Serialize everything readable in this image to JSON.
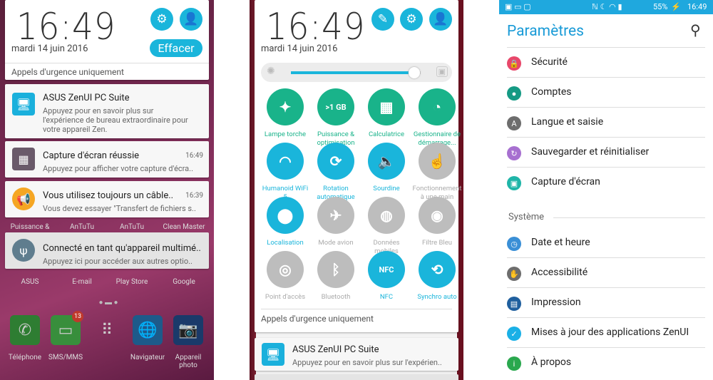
{
  "panel1": {
    "time": "16:49",
    "date": "mardi 14 juin 2016",
    "clear_label": "Effacer",
    "emergency": "Appels d'urgence uniquement",
    "notifications": [
      {
        "title": "ASUS ZenUI PC Suite",
        "text": [
          "Appuyez pour en savoir plus sur",
          "l'expérience de bureau extraordinaire pour",
          "votre appareil Zen."
        ],
        "time": ""
      },
      {
        "title": "Capture d'écran réussie",
        "text": [
          "Appuyez pour afficher votre capture d'écra.."
        ],
        "time": "16:49"
      },
      {
        "title": "Vous utilisez toujours un câble..",
        "text": [
          "Vous devez essayer \"Transfert de fichiers s.."
        ],
        "time": "16:39"
      },
      {
        "title": "Connecté en tant qu'appareil multimé..",
        "text": [
          "Appuyez ici pour accéder aux autres optio.."
        ],
        "time": ""
      }
    ],
    "wallpaper_labels_top": [
      "Puissance &",
      "AnTuTu",
      "AnTuTu",
      "Clean Master"
    ],
    "wallpaper_labels_mid": [
      "ASUS",
      "E-mail",
      "Play Store",
      "Google"
    ],
    "dock": [
      {
        "label": "Téléphone"
      },
      {
        "label": "SMS/MMS",
        "badge": "13"
      },
      {
        "label": ""
      },
      {
        "label": "Navigateur"
      },
      {
        "label": "Appareil photo"
      }
    ]
  },
  "panel2": {
    "time": "16:49",
    "date": "mardi 14 juin 2016",
    "brightness_percent": 95,
    "emergency": "Appels d'urgence uniquement",
    "tiles": [
      {
        "label": "Lampe torche",
        "on": true,
        "icon": "flashlight-icon",
        "glyph": "✦",
        "color": "#19b38a"
      },
      {
        "label": "Puissance & optimisation",
        "on": true,
        "icon": "boost-icon",
        "glyph": ">1 GB",
        "color": "#19b38a"
      },
      {
        "label": "Calculatrice",
        "on": true,
        "icon": "calculator-icon",
        "glyph": "▦",
        "color": "#19b38a"
      },
      {
        "label": "Gestionnaire de démarrage...",
        "on": true,
        "icon": "startup-manager-icon",
        "glyph": "◔",
        "color": "#19b38a"
      },
      {
        "label": "Humanoid WiFi 5",
        "on": true,
        "icon": "wifi-icon",
        "glyph": "◠",
        "color": "#1ab5db"
      },
      {
        "label": "Rotation automatique",
        "on": true,
        "icon": "rotation-icon",
        "glyph": "⟳",
        "color": "#1ab5db"
      },
      {
        "label": "Sourdine",
        "on": true,
        "icon": "mute-icon",
        "glyph": "🔈",
        "color": "#1ab5db"
      },
      {
        "label": "Fonctionnement à une main",
        "on": false,
        "icon": "one-hand-icon",
        "glyph": "☝",
        "color": "#bdbdbd"
      },
      {
        "label": "Localisation",
        "on": true,
        "icon": "location-icon",
        "glyph": "⬤",
        "color": "#1ab5db"
      },
      {
        "label": "Mode avion",
        "on": false,
        "icon": "airplane-icon",
        "glyph": "✈",
        "color": "#bdbdbd"
      },
      {
        "label": "Données mobiles",
        "on": false,
        "icon": "mobile-data-icon",
        "glyph": "◍",
        "color": "#bdbdbd"
      },
      {
        "label": "Filtre Bleu",
        "on": false,
        "icon": "blue-filter-icon",
        "glyph": "◉",
        "color": "#bdbdbd"
      },
      {
        "label": "Point d'accès",
        "on": false,
        "icon": "hotspot-icon",
        "glyph": "◎",
        "color": "#bdbdbd"
      },
      {
        "label": "Bluetooth",
        "on": false,
        "icon": "bluetooth-icon",
        "glyph": "ᛒ",
        "color": "#bdbdbd"
      },
      {
        "label": "NFC",
        "on": true,
        "icon": "nfc-icon",
        "glyph": "NFC",
        "color": "#1ab5db"
      },
      {
        "label": "Synchro auto",
        "on": true,
        "icon": "sync-icon",
        "glyph": "⟲",
        "color": "#1ab5db"
      }
    ],
    "notification": {
      "title": "ASUS ZenUI PC Suite",
      "text": "Appuyez pour en savoir plus sur l'expérien.."
    }
  },
  "panel3": {
    "status": {
      "battery": "55%",
      "time": "16:49"
    },
    "title": "Paramètres",
    "accent": "#1a9bd7",
    "items_top": [
      {
        "label": "Sécurité",
        "color": "#e8476a",
        "glyph": "🔒"
      },
      {
        "label": "Comptes",
        "color": "#159a84",
        "glyph": "●"
      },
      {
        "label": "Langue et saisie",
        "color": "#6d6d6d",
        "glyph": "A"
      },
      {
        "label": "Sauvegarder et réinitialiser",
        "color": "#a770d0",
        "glyph": "↻"
      },
      {
        "label": "Capture d'écran",
        "color": "#1fb5a8",
        "glyph": "▣"
      }
    ],
    "section": "Système",
    "items_sys": [
      {
        "label": "Date et heure",
        "color": "#3a8fd6",
        "glyph": "◷"
      },
      {
        "label": "Accessibilité",
        "color": "#6d6d6d",
        "glyph": "✋"
      },
      {
        "label": "Impression",
        "color": "#1f5f9e",
        "glyph": "▤"
      },
      {
        "label": "Mises à jour des applications ZenUI",
        "color": "#1ab0e6",
        "glyph": "✓"
      },
      {
        "label": "À propos",
        "color": "#2aa84e",
        "glyph": "i"
      }
    ]
  }
}
